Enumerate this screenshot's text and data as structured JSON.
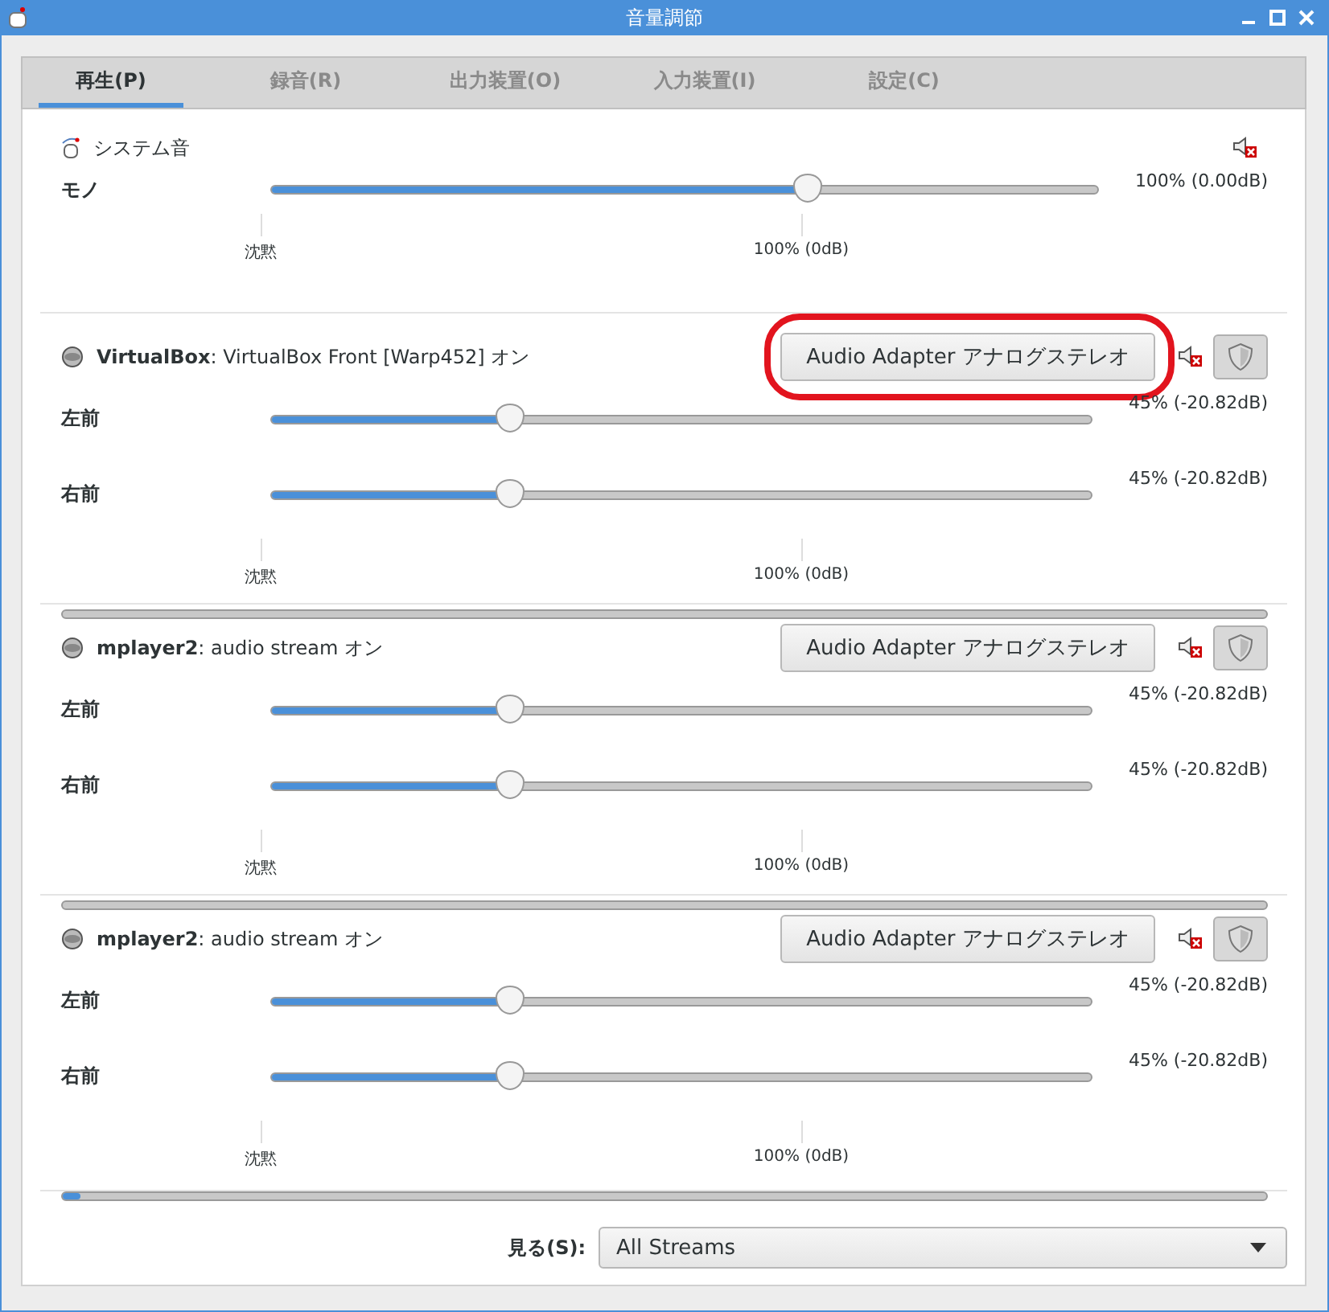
{
  "window": {
    "title": "音量調節"
  },
  "tabs": [
    {
      "label": "再生(P)",
      "selected": true
    },
    {
      "label": "録音(R)",
      "selected": false
    },
    {
      "label": "出力装置(O)",
      "selected": false
    },
    {
      "label": "入力装置(I)",
      "selected": false
    },
    {
      "label": "設定(C)",
      "selected": false
    }
  ],
  "system_sound": {
    "name": "システム音",
    "channels": [
      {
        "name": "モノ",
        "level": 0.65,
        "reading": "100% (0.00dB)"
      }
    ],
    "ticks": [
      "沈黙",
      "100% (0dB)"
    ]
  },
  "streams": [
    {
      "title": "**VirtualBox**: VirtualBox Front [Warp452]  オン",
      "device": "Audio Adapter アナログステレオ",
      "highlighted": true,
      "lock_channels": true,
      "channels": [
        {
          "name": "左前",
          "level": 0.29,
          "reading": "45% (-20.82dB)"
        },
        {
          "name": "右前",
          "level": 0.29,
          "reading": "45% (-20.82dB)"
        }
      ],
      "ticks": [
        "沈黙",
        "100% (0dB)"
      ],
      "meter": {
        "level": 0
      }
    },
    {
      "title": "**mplayer2**: audio stream  オン",
      "device": "Audio Adapter アナログステレオ",
      "highlighted": false,
      "lock_channels": true,
      "channels": [
        {
          "name": "左前",
          "level": 0.29,
          "reading": "45% (-20.82dB)"
        },
        {
          "name": "右前",
          "level": 0.29,
          "reading": "45% (-20.82dB)"
        }
      ],
      "ticks": [
        "沈黙",
        "100% (0dB)"
      ],
      "meter": {
        "level": 0
      }
    },
    {
      "title": "**mplayer2**: audio stream  オン",
      "device": "Audio Adapter アナログステレオ",
      "highlighted": false,
      "lock_channels": true,
      "channels": [
        {
          "name": "左前",
          "level": 0.29,
          "reading": "45% (-20.82dB)"
        },
        {
          "name": "右前",
          "level": 0.29,
          "reading": "45% (-20.82dB)"
        }
      ],
      "ticks": [
        "沈黙",
        "100% (0dB)"
      ],
      "meter": {
        "level": 0.015
      }
    }
  ],
  "view": {
    "label": "見る(S):",
    "value": "All Streams"
  }
}
